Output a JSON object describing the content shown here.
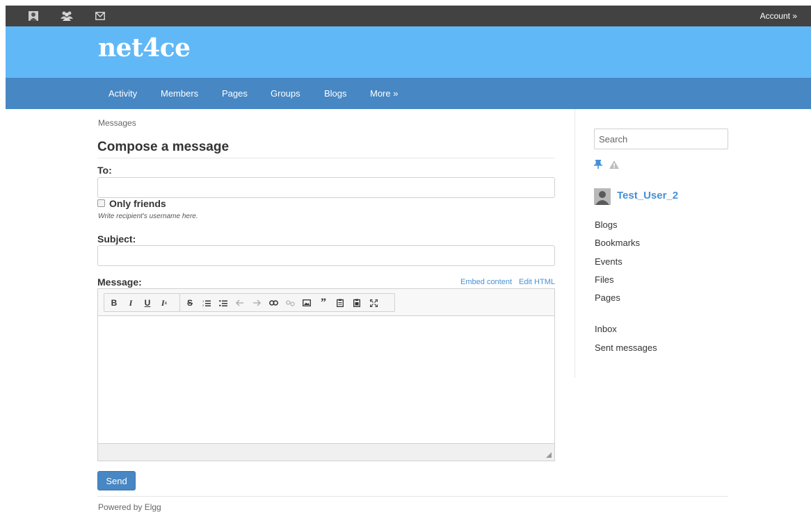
{
  "topbar": {
    "icons": [
      "profile-icon",
      "friends-icon",
      "mail-icon"
    ],
    "account_label": "Account »"
  },
  "header": {
    "site_title": "net4ce"
  },
  "nav": {
    "items": [
      {
        "label": "Activity"
      },
      {
        "label": "Members"
      },
      {
        "label": "Pages"
      },
      {
        "label": "Groups"
      },
      {
        "label": "Blogs"
      },
      {
        "label": "More »"
      }
    ]
  },
  "breadcrumb": "Messages",
  "form": {
    "title": "Compose a message",
    "to_label": "To:",
    "to_value": "",
    "only_friends_label": "Only friends",
    "only_friends_checked": false,
    "to_help": "Write recipient's username here.",
    "subject_label": "Subject:",
    "subject_value": "",
    "message_label": "Message:",
    "embed_content": "Embed content",
    "edit_html": "Edit HTML",
    "toolbar_icons": [
      "bold",
      "italic",
      "underline",
      "remove-format",
      "strikethrough",
      "numbered-list",
      "bulleted-list",
      "undo",
      "redo",
      "link",
      "unlink",
      "image",
      "blockquote",
      "paste",
      "paste-from-word",
      "maximize"
    ],
    "send_label": "Send"
  },
  "footer": {
    "powered_by": "Powered by Elgg"
  },
  "sidebar": {
    "search_placeholder": "Search",
    "owner_name": "Test_User_2",
    "owner_links": [
      "Blogs",
      "Bookmarks",
      "Events",
      "Files",
      "Pages"
    ],
    "message_links": [
      "Inbox",
      "Sent messages"
    ]
  },
  "colors": {
    "topbar": "#424242",
    "header": "#60b8f7",
    "nav": "#4787c3",
    "link": "#4690d6",
    "send_button": "#4787c3"
  }
}
